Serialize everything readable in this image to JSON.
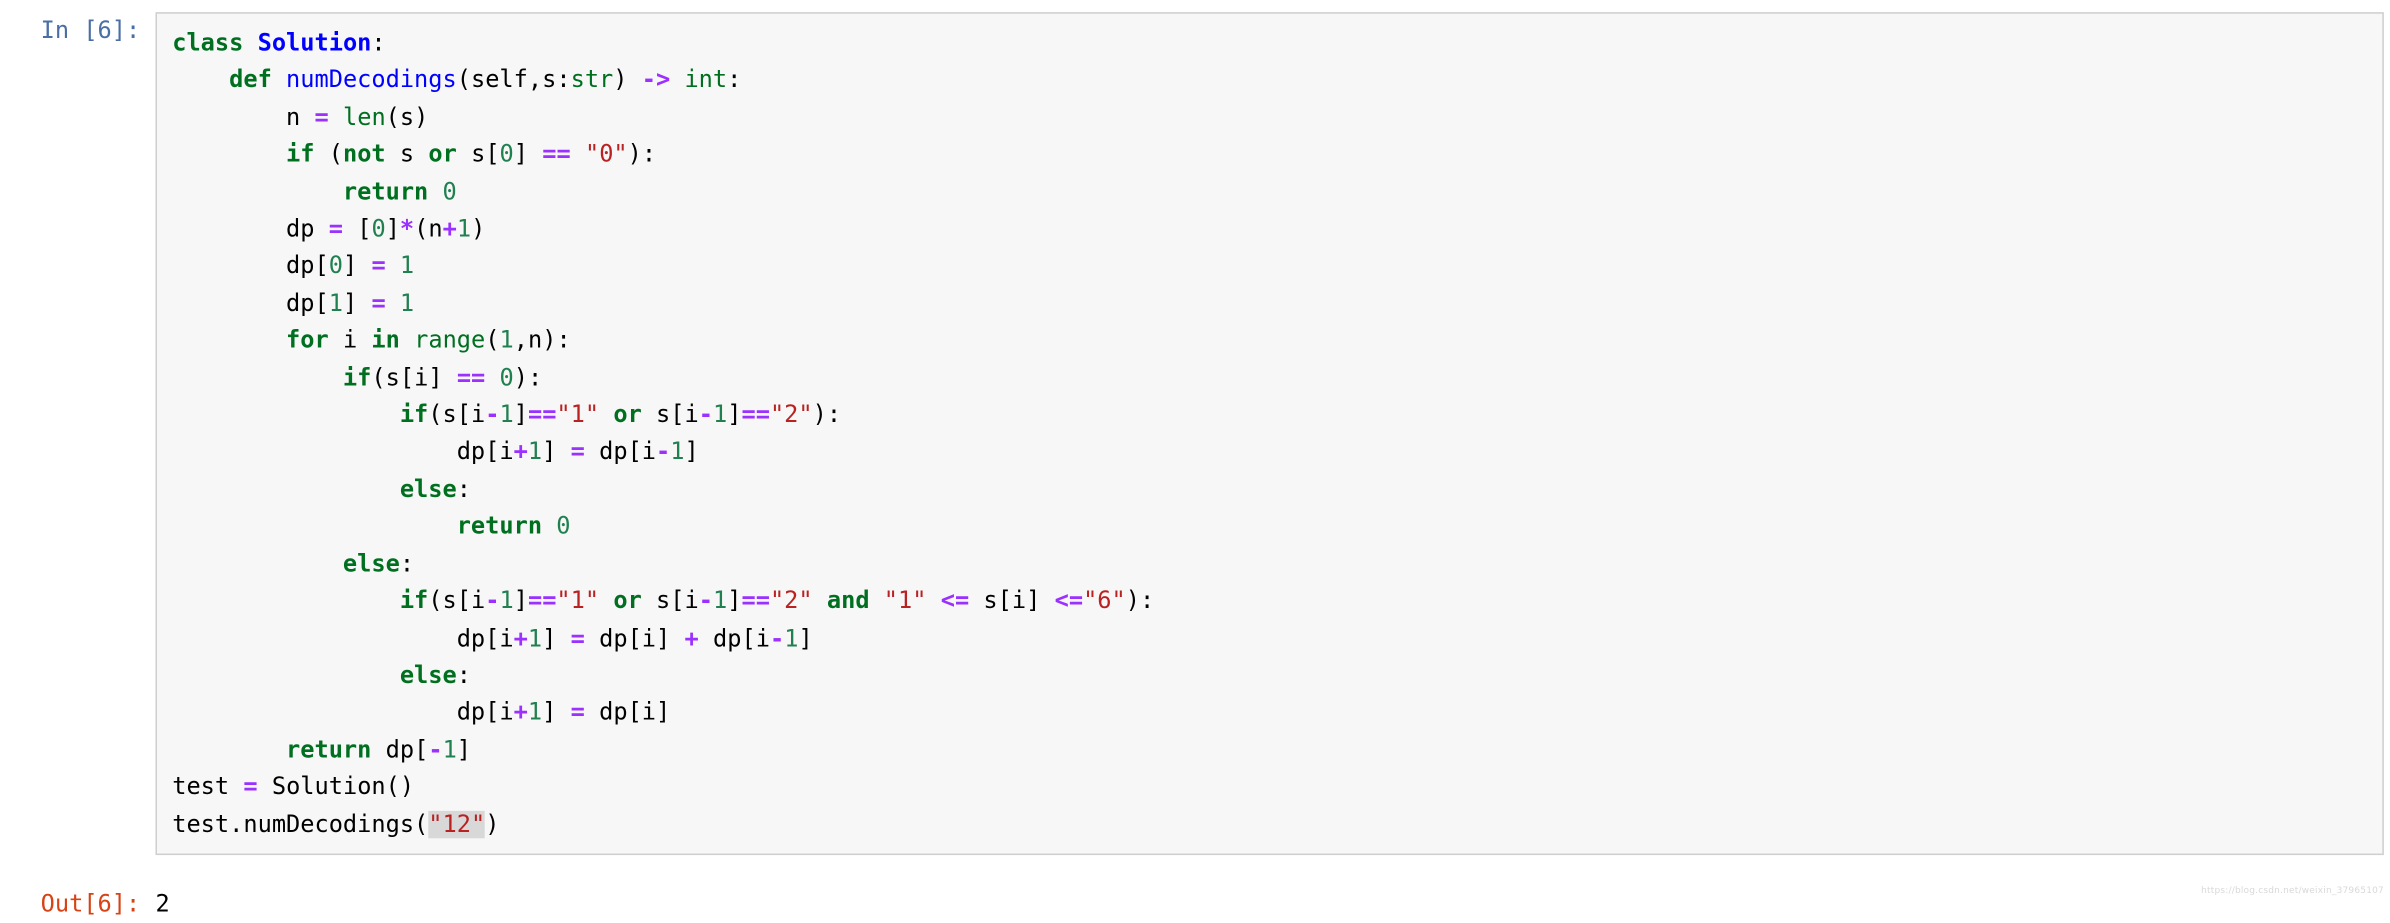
{
  "cell": {
    "input_prompt": "In [6]:",
    "output_prompt": "Out[6]:",
    "output_value": "2",
    "execution_count": 6,
    "language": "python",
    "code_text": "class Solution:\n    def numDecodings(self,s:str) -> int:\n        n = len(s)\n        if (not s or s[0] == \"0\"):\n            return 0\n        dp = [0]*(n+1)\n        dp[0] = 1\n        dp[1] = 1\n        for i in range(1,n):\n            if(s[i] == 0):\n                if(s[i-1]==\"1\" or s[i-1]==\"2\"):\n                    dp[i+1] = dp[i-1]\n                else:\n                    return 0\n            else:\n                if(s[i-1]==\"1\" or s[i-1]==\"2\" and \"1\" <= s[i] <=\"6\"):\n                    dp[i+1] = dp[i] + dp[i-1]\n                else:\n                    dp[i+1] = dp[i]\n        return dp[-1]\ntest = Solution()\ntest.numDecodings(\"12\")",
    "code_lines": [
      "class Solution:",
      "    def numDecodings(self,s:str) -> int:",
      "        n = len(s)",
      "        if (not s or s[0] == \"0\"):",
      "            return 0",
      "        dp = [0]*(n+1)",
      "        dp[0] = 1",
      "        dp[1] = 1",
      "        for i in range(1,n):",
      "            if(s[i] == 0):",
      "                if(s[i-1]==\"1\" or s[i-1]==\"2\"):",
      "                    dp[i+1] = dp[i-1]",
      "                else:",
      "                    return 0",
      "            else:",
      "                if(s[i-1]==\"1\" or s[i-1]==\"2\" and \"1\" <= s[i] <=\"6\"):",
      "                    dp[i+1] = dp[i] + dp[i-1]",
      "                else:",
      "                    dp[i+1] = dp[i]",
      "        return dp[-1]",
      "test = Solution()",
      "test.numDecodings(\"12\")"
    ]
  },
  "watermark": {
    "text": "https://blog.csdn.net/weixin_37965107"
  },
  "colors": {
    "cell_background": "#f7f7f7",
    "cell_border": "#cfcfcf",
    "in_prompt": "#4a6fa5",
    "out_prompt": "#d84315",
    "keyword": "#007020",
    "class_name": "#0000ff",
    "number": "#208050",
    "string": "#ba2121",
    "operator": "#9b30ff",
    "highlight": "#d8d8d8"
  }
}
